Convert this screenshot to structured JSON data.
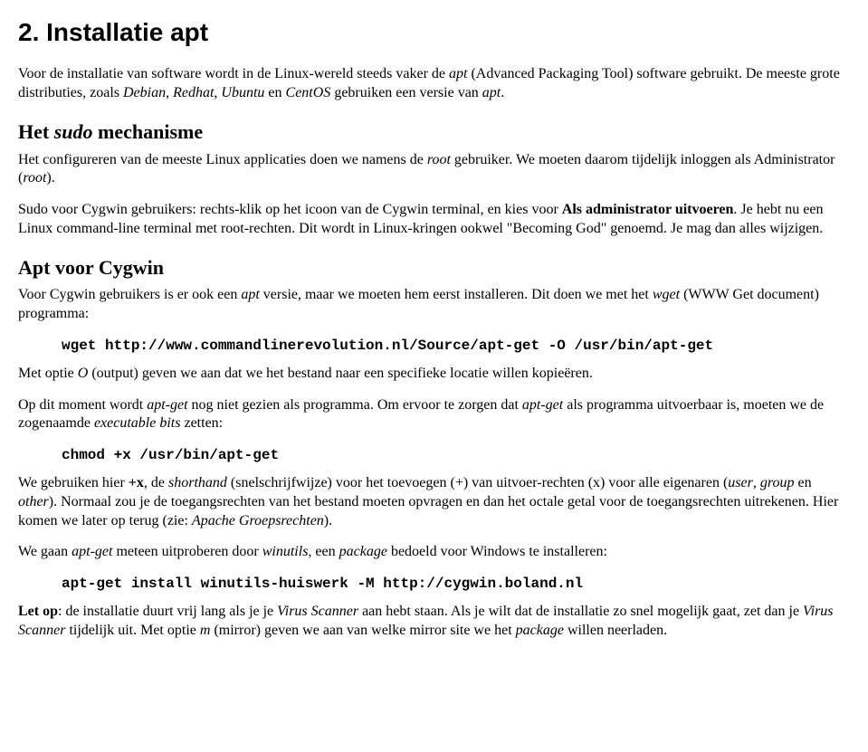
{
  "title": "2. Installatie apt",
  "p1": {
    "a": "Voor de installatie van software wordt in de Linux-wereld steeds vaker de ",
    "b": "apt",
    "c": " (Advanced Packaging Tool) software gebruikt. De meeste grote distributies, zoals ",
    "d": "Debian",
    "e": ", ",
    "f": "Redhat",
    "g": ", ",
    "h": "Ubuntu",
    "i": " en ",
    "j": "CentOS",
    "k": " gebruiken een versie van ",
    "l": "apt",
    "m": "."
  },
  "h2a": {
    "a": "Het ",
    "b": "sudo",
    "c": " mechanisme"
  },
  "p2": {
    "a": "Het configureren van de meeste Linux applicaties doen we namens de ",
    "b": "root",
    "c": " gebruiker. We moeten daarom tijdelijk inloggen als Administrator (",
    "d": "root",
    "e": ")."
  },
  "p3": {
    "a": "Sudo voor Cygwin gebruikers: rechts-klik op het icoon van de Cygwin terminal, en kies voor ",
    "b": "Als administrator uitvoeren",
    "c": ". Je hebt nu een Linux command-line terminal met root-rechten. Dit wordt in Linux-kringen ookwel \"Becoming God\" genoemd. Je mag dan alles wijzigen."
  },
  "h2b": "Apt voor Cygwin",
  "p4": {
    "a": "Voor Cygwin gebruikers is er ook een ",
    "b": "apt",
    "c": " versie, maar we moeten hem eerst installeren. Dit doen we met het ",
    "d": "wget",
    "e": " (WWW Get document) programma:"
  },
  "code1": "wget http://www.commandlinerevolution.nl/Source/apt-get -O /usr/bin/apt-get",
  "p5": {
    "a": "Met optie ",
    "b": "O",
    "c": " (output) geven we aan dat we het bestand naar een specifieke locatie willen kopieëren."
  },
  "p6": {
    "a": "Op dit moment wordt ",
    "b": "apt-get",
    "c": " nog niet gezien als programma. Om ervoor te zorgen dat ",
    "d": "apt-get",
    "e": " als programma uitvoerbaar is, moeten we de zogenaamde ",
    "f": "executable bits",
    "g": " zetten:"
  },
  "code2": "chmod +x /usr/bin/apt-get",
  "p7": {
    "a": "We gebruiken hier ",
    "b": "+x",
    "c": ", de ",
    "d": "shorthand",
    "e": " (snelschrijfwijze) voor het toevoegen (+) van uitvoer-rechten (x) voor alle eigenaren (",
    "f": "user",
    "g": ", ",
    "h": "group",
    "i": " en ",
    "j": "other",
    "k": "). Normaal zou je de toegangsrechten van het bestand moeten opvragen en dan het octale getal voor de toegangsrechten uitrekenen. Hier komen we later op terug (zie: ",
    "l": "Apache Groepsrechten",
    "m": ")."
  },
  "p8": {
    "a": "We gaan ",
    "b": "apt-get",
    "c": " meteen uitproberen door ",
    "d": "winutils",
    "e": ", een ",
    "f": "package",
    "g": " bedoeld voor Windows te installeren:"
  },
  "code3": "apt-get install winutils-huiswerk -M http://cygwin.boland.nl",
  "p9": {
    "a": "Let op",
    "b": ": de installatie duurt vrij lang als je je ",
    "c": "Virus Scanner",
    "d": " aan hebt staan. Als je wilt dat de installatie zo snel mogelijk gaat, zet dan je ",
    "e": "Virus Scanner",
    "f": " tijdelijk uit. Met optie ",
    "g": "m",
    "h": " (mirror) geven we aan van welke mirror site we het ",
    "i": "package",
    "j": " willen neerladen."
  }
}
